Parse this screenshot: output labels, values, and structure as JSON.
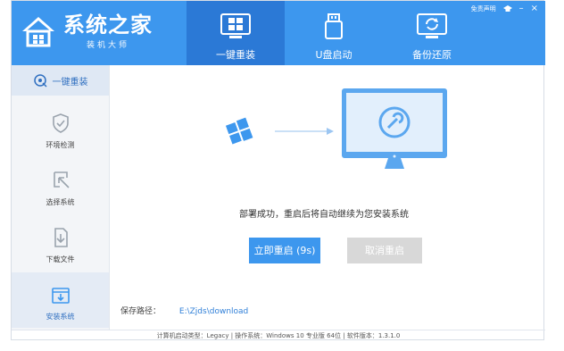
{
  "brand": {
    "title": "系统之家",
    "subtitle": "装机大师"
  },
  "tray": {
    "disclaimer": "免责声明",
    "minimize": "–",
    "close": "×"
  },
  "top_nav": [
    {
      "label": "一键重装",
      "icon": "windows-icon",
      "active": true
    },
    {
      "label": "U盘启动",
      "icon": "usb-drive-icon",
      "active": false
    },
    {
      "label": "备份还原",
      "icon": "backup-restore-icon",
      "active": false
    }
  ],
  "sidebar": [
    {
      "label": "一键重装",
      "icon": "reinstall-icon"
    },
    {
      "label": "环境检测",
      "icon": "shield-check-icon"
    },
    {
      "label": "选择系统",
      "icon": "select-system-icon"
    },
    {
      "label": "下载文件",
      "icon": "download-file-icon"
    },
    {
      "label": "安装系统",
      "icon": "install-system-icon",
      "active": true
    }
  ],
  "main": {
    "message": "部署成功，重启后将自动继续为您安装系统",
    "restart_button": "立即重启 (9s)",
    "cancel_button": "取消重启",
    "save_label": "保存路径：",
    "save_path": "E:\\Zjds\\download"
  },
  "status_bar": "计算机启动类型：Legacy | 操作系统：Windows 10 专业版 64位 | 软件版本：1.3.1.0",
  "colors": {
    "accent": "#3d97ee",
    "accent_dark": "#2b79d6",
    "sidebar_bg": "#f3f5f8",
    "disabled": "#d8d8d8"
  }
}
